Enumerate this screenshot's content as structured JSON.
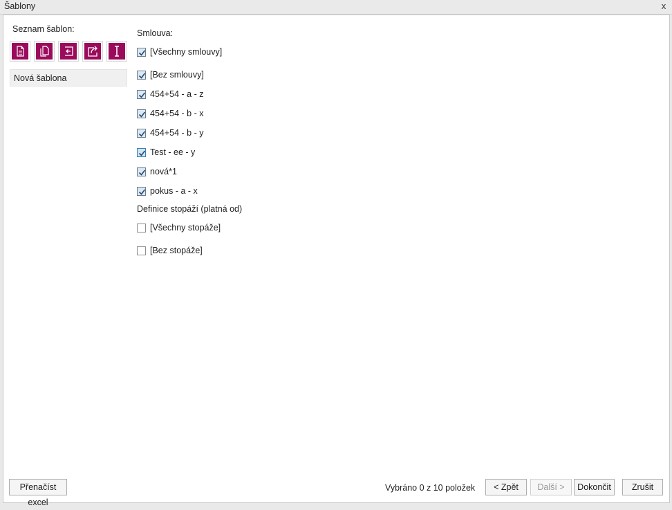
{
  "window": {
    "title": "Šablony",
    "close_glyph": "x"
  },
  "left": {
    "list_label": "Seznam šablon:",
    "toolbar": [
      {
        "icon": "new-document-icon"
      },
      {
        "icon": "copy-document-icon"
      },
      {
        "icon": "import-icon"
      },
      {
        "icon": "export-icon"
      },
      {
        "icon": "rename-icon"
      }
    ],
    "templates": [
      {
        "label": "Nová šablona"
      }
    ],
    "accent_color": "#9b0b5c"
  },
  "main": {
    "contract_label": "Smlouva:",
    "contracts": [
      {
        "label": "[Všechny smlouvy]",
        "checked": true
      },
      {
        "label": "[Bez smlouvy]",
        "checked": true
      },
      {
        "label": "454+54 - a - z",
        "checked": true
      },
      {
        "label": "454+54 - b - x",
        "checked": true
      },
      {
        "label": "454+54 - b - y",
        "checked": true
      },
      {
        "label": "Test - ee - y",
        "checked": true
      },
      {
        "label": "nová*1",
        "checked": true
      },
      {
        "label": "pokus - a - x",
        "checked": true
      }
    ],
    "stopaz_label": "Definice stopáží (platná od)",
    "stopaze": [
      {
        "label": "[Všechny stopáže]",
        "checked": false
      },
      {
        "label": "[Bez stopáže]",
        "checked": false
      }
    ]
  },
  "footer": {
    "reload_button": "Přenačíst excel",
    "status": "Vybráno 0 z 10 položek",
    "back_button": "< Zpět",
    "next_button": "Další >",
    "finish_button": "Dokončit",
    "cancel_button": "Zrušit"
  }
}
